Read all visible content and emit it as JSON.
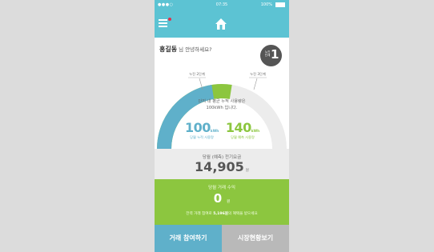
{
  "status_bar": {
    "signal": "●●●○ ",
    "time": "07:35",
    "battery": "100%"
  },
  "header": {
    "menu_icon": "hamburger-icon",
    "home_icon": "home-icon"
  },
  "greeting": {
    "name": "홍길동",
    "suffix": " 님 안녕하세요?"
  },
  "badge": {
    "line1": "누진",
    "line2": "단계",
    "value": "1"
  },
  "gauge": {
    "left_label": "누진 2단계",
    "right_label": "누진 3단계",
    "usage_fraction": 0.45,
    "forecast_fraction": 0.55,
    "colors": {
      "usage": "#5fb0ca",
      "forecast": "#8cc63f",
      "track": "#ececec"
    }
  },
  "summary": {
    "line1": "단지 내 평균 누적 사용량은",
    "line2": "100kWh 입니다."
  },
  "usage": {
    "value": "100",
    "unit": "kWh",
    "caption": "당월 누적 사용량"
  },
  "forecast": {
    "value": "140",
    "unit": "kWh",
    "caption": "당월 예측 사용량"
  },
  "fee": {
    "label": "당월 (예측) 전기요금",
    "value": "14,905",
    "unit": "원"
  },
  "trade": {
    "label": "당월 거래 수익",
    "value": "0",
    "unit": "원",
    "note_prefix": "전력 거래 참여로 ",
    "note_amount": "5,196원",
    "note_suffix": "의 혜택을 받으세요"
  },
  "buttons": {
    "join": "거래 참여하기",
    "market": "시장현황보기"
  }
}
